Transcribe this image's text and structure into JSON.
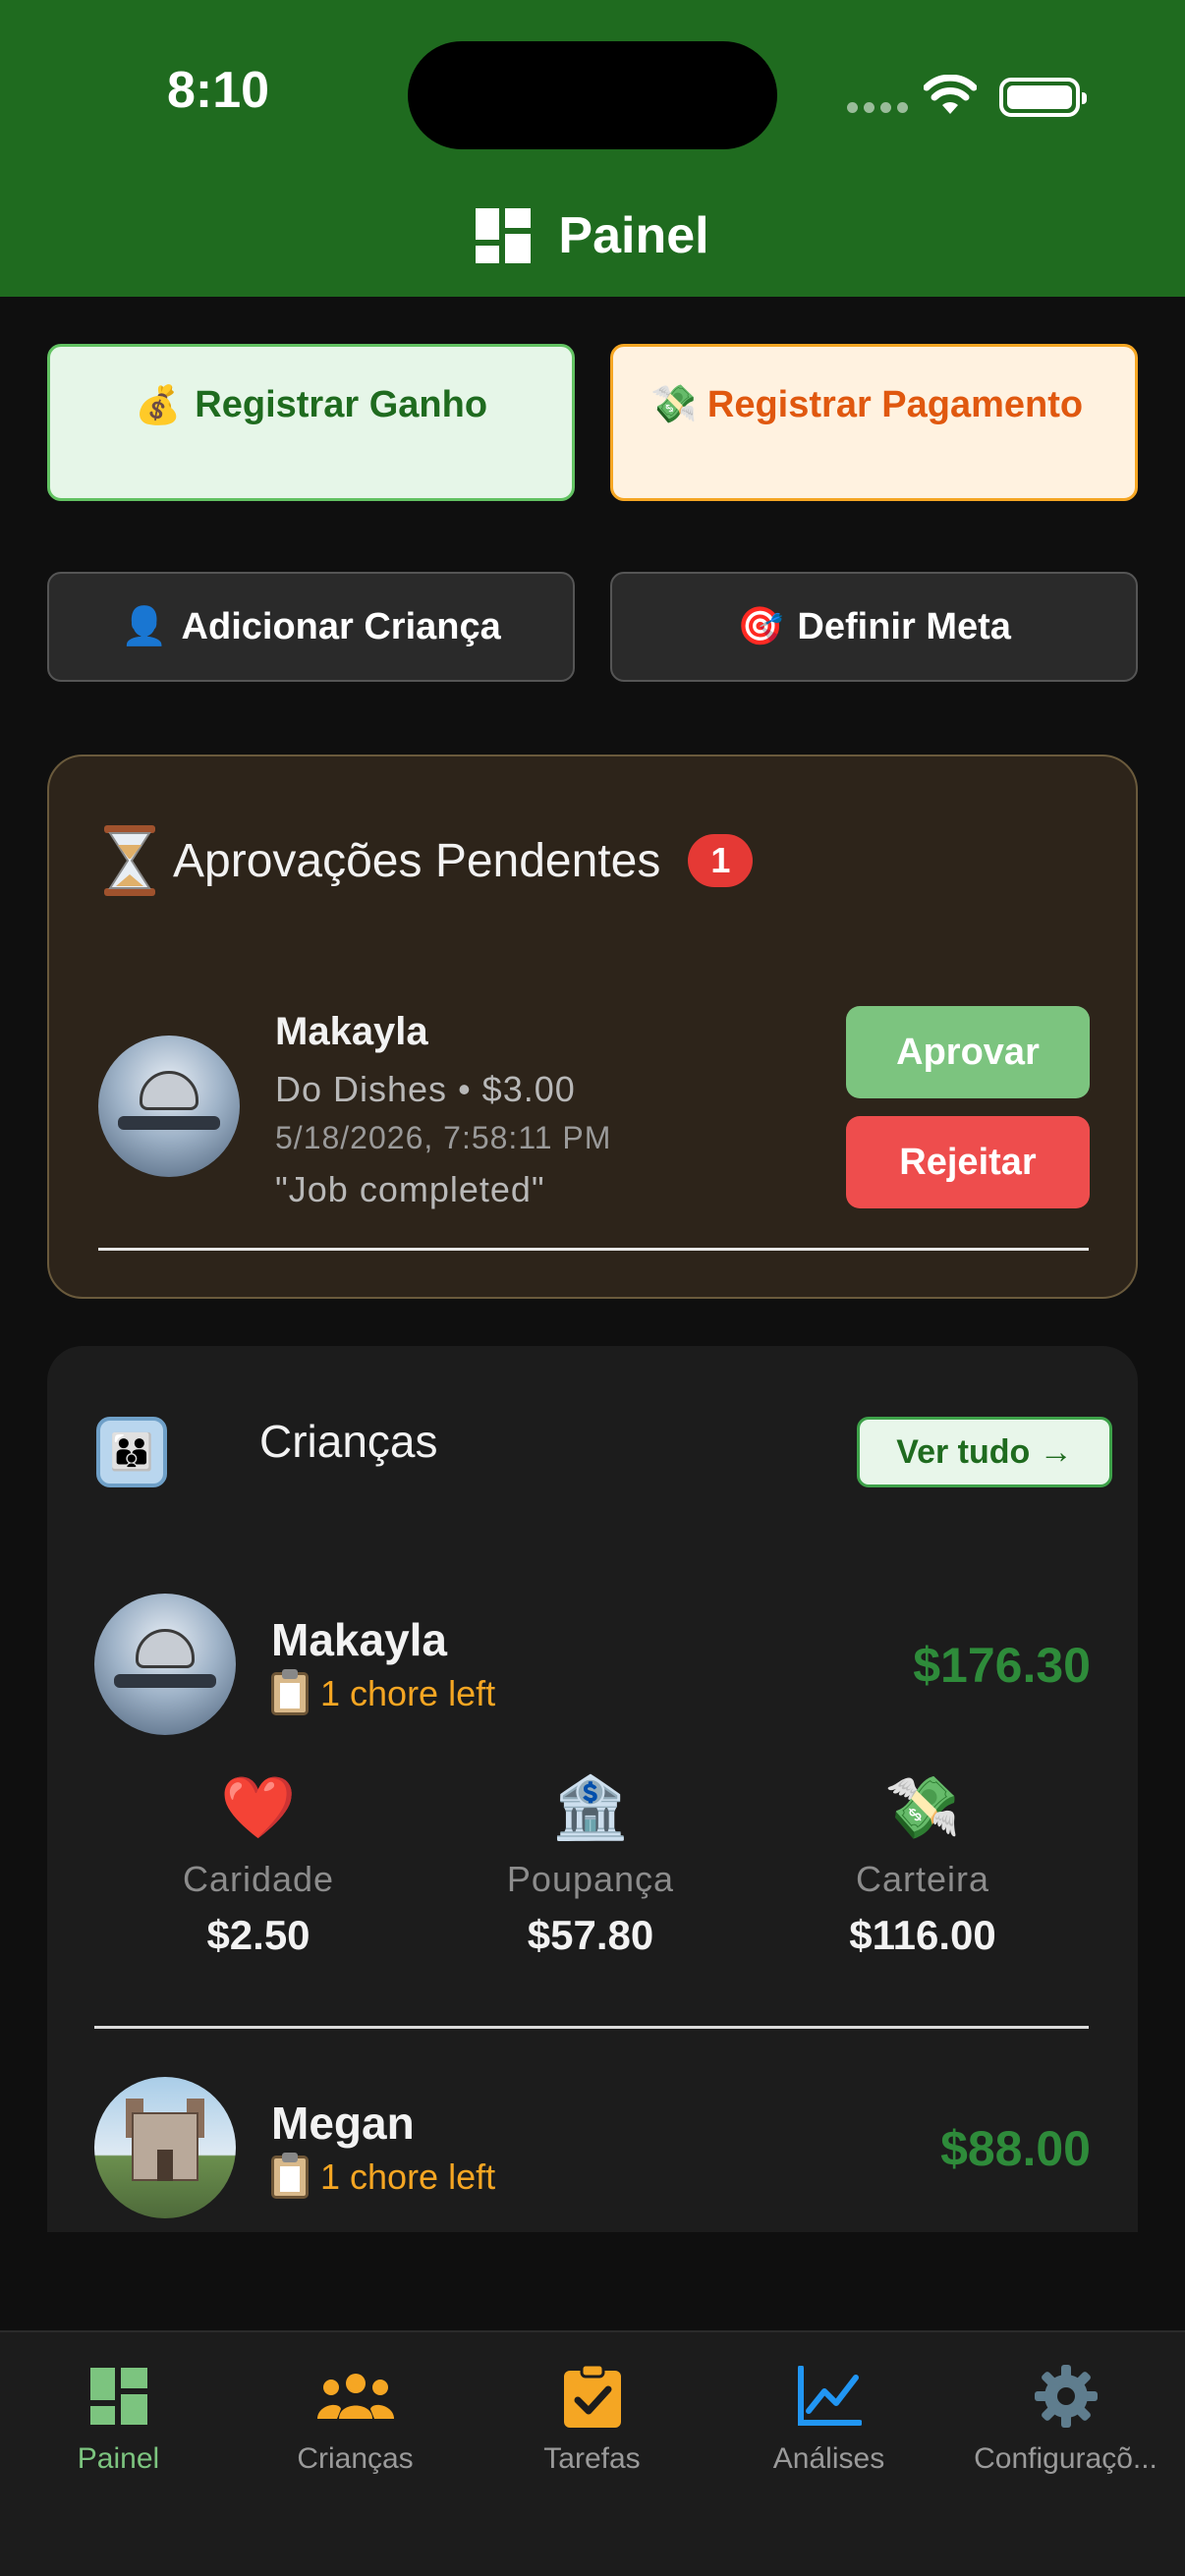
{
  "status_bar": {
    "time": "8:10"
  },
  "header": {
    "title": "Painel"
  },
  "actions": {
    "register_earning": "Registrar Ganho",
    "register_payment": "Registrar Pagamento",
    "add_child": "Adicionar Criança",
    "set_goal": "Definir Meta"
  },
  "pending": {
    "title": "Aprovações Pendentes",
    "count": "1",
    "item": {
      "name": "Makayla",
      "task": "Do Dishes • $3.00",
      "date": "5/18/2026, 7:58:11 PM",
      "note": "\"Job completed\"",
      "approve_label": "Aprovar",
      "reject_label": "Rejeitar"
    }
  },
  "children": {
    "title": "Crianças",
    "see_all": "Ver tudo →",
    "items": [
      {
        "name": "Makayla",
        "chores": "1 chore left",
        "total": "$176.30",
        "buckets": [
          {
            "label": "Caridade",
            "value": "$2.50",
            "icon": "heart-icon"
          },
          {
            "label": "Poupança",
            "value": "$57.80",
            "icon": "bank-icon"
          },
          {
            "label": "Carteira",
            "value": "$116.00",
            "icon": "money-wings-icon"
          }
        ]
      },
      {
        "name": "Megan",
        "chores": "1 chore left",
        "total": "$88.00"
      }
    ]
  },
  "tabs": [
    {
      "label": "Painel",
      "icon": "dashboard-icon",
      "active": true
    },
    {
      "label": "Crianças",
      "icon": "people-icon"
    },
    {
      "label": "Tarefas",
      "icon": "clipboard-check-icon"
    },
    {
      "label": "Análises",
      "icon": "chart-line-icon"
    },
    {
      "label": "Configuraçõ...",
      "icon": "gear-icon"
    }
  ],
  "colors": {
    "header_bg": "#1f6b1f",
    "accent_green": "#2e8b3a",
    "tab_active": "#7cc47f",
    "chore_orange": "#f5a623",
    "reject_red": "#ee4d4d"
  }
}
